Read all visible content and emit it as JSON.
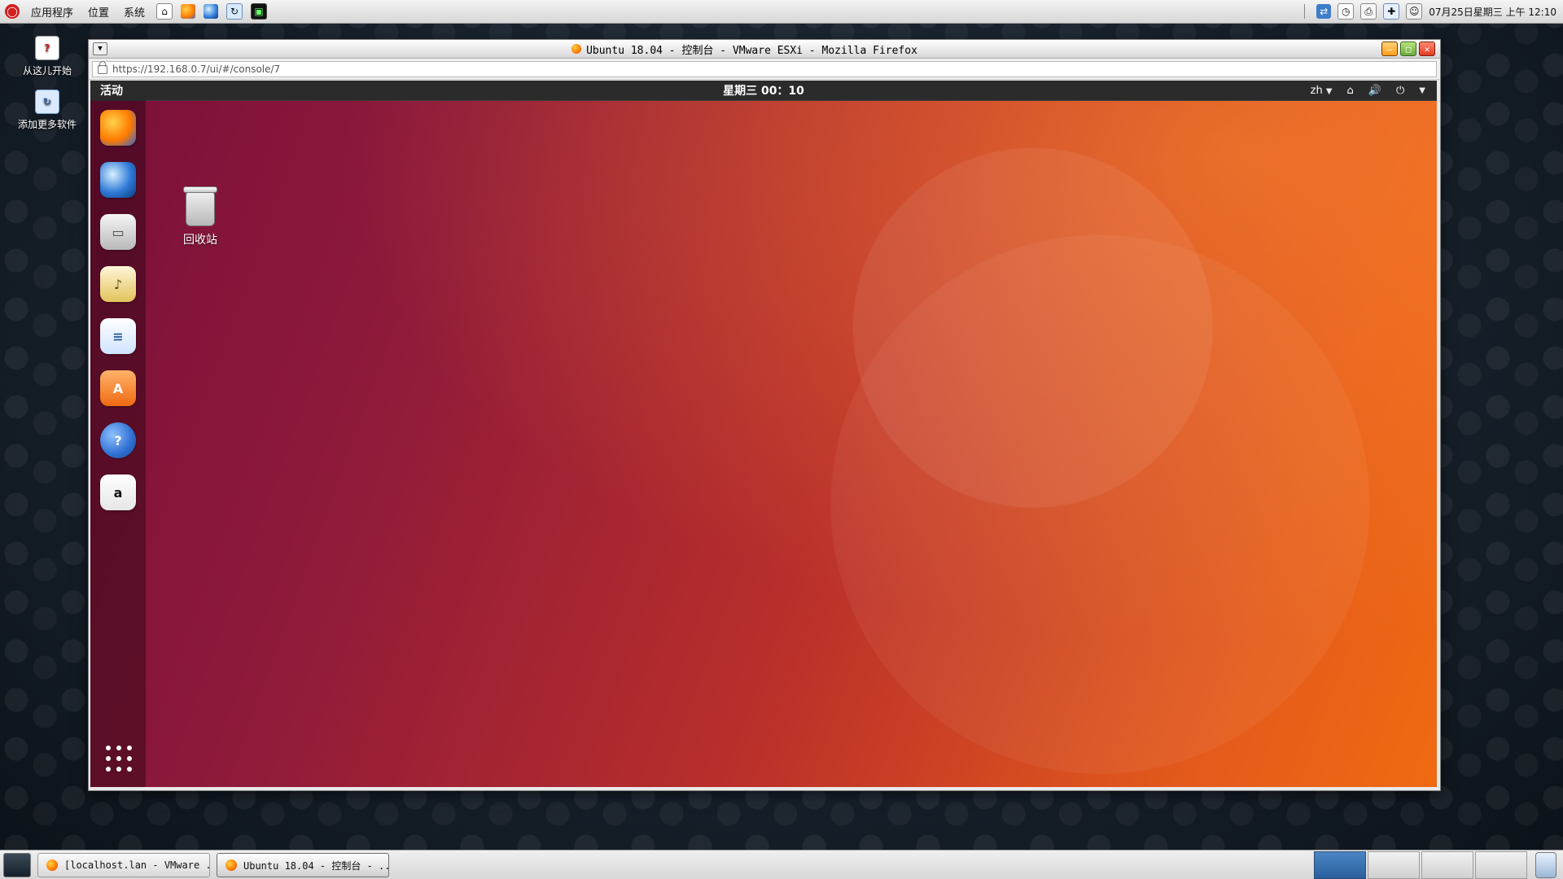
{
  "top_panel": {
    "menus": [
      "应用程序",
      "位置",
      "系统"
    ],
    "datetime": "07月25日星期三 上午 12:10"
  },
  "desktop": {
    "icons": [
      {
        "label": "从这儿开始",
        "icon": "help-icon",
        "color": "#d21f1f"
      },
      {
        "label": "添加更多软件",
        "icon": "add-software-icon",
        "color": "#6aa7ff"
      }
    ]
  },
  "firefox": {
    "title": "Ubuntu 18.04 - 控制台 - VMware ESXi - Mozilla Firefox",
    "url": "https://192.168.0.7/ui/#/console/7"
  },
  "ubuntu": {
    "activities": "活动",
    "clock": "星期三 00：10",
    "status": {
      "lang": "zh"
    },
    "desktop_item": "回收站"
  },
  "taskbar": {
    "tasks": [
      {
        "label": "[localhost.lan - VMware ..."
      },
      {
        "label": "Ubuntu 18.04 - 控制台 - ..."
      }
    ]
  }
}
